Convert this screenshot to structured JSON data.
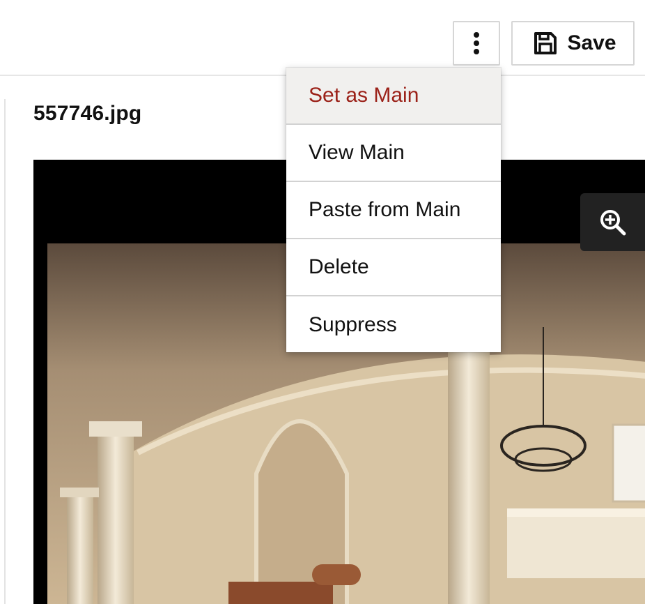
{
  "toolbar": {
    "more_icon": "vertical-ellipsis-icon",
    "save_icon": "floppy-disk-icon",
    "save_label": "Save"
  },
  "file": {
    "name": "557746.jpg"
  },
  "viewer": {
    "zoom_icon": "zoom-in-icon"
  },
  "menu": {
    "items": [
      {
        "label": "Set as Main",
        "color": "#9b2118",
        "highlighted": true
      },
      {
        "label": "View Main"
      },
      {
        "label": "Paste from Main"
      },
      {
        "label": "Delete"
      },
      {
        "label": "Suppress"
      }
    ]
  }
}
